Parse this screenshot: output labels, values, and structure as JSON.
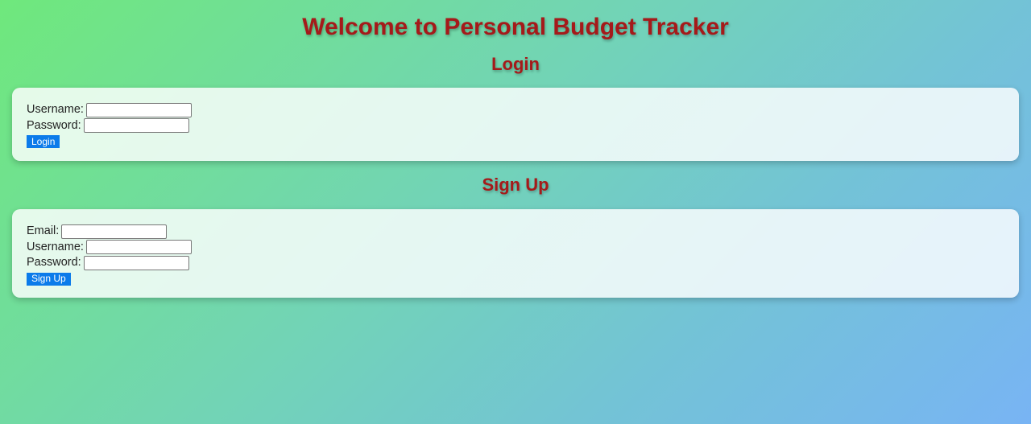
{
  "page": {
    "title": "Welcome to Personal Budget Tracker"
  },
  "login": {
    "heading": "Login",
    "username_label": "Username:",
    "username_value": "",
    "password_label": "Password:",
    "password_value": "",
    "button_label": "Login"
  },
  "signup": {
    "heading": "Sign Up",
    "email_label": "Email:",
    "email_value": "",
    "username_label": "Username:",
    "username_value": "",
    "password_label": "Password:",
    "password_value": "",
    "button_label": "Sign Up"
  },
  "colors": {
    "heading": "#a51a1a",
    "button": "#0b7bea",
    "gradient_start": "#6fe87c",
    "gradient_end": "#78b4f4"
  }
}
